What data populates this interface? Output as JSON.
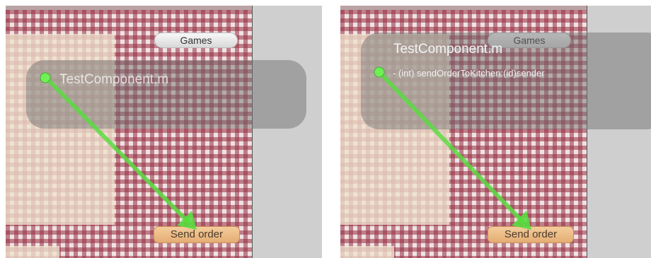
{
  "panels": [
    {
      "component_label": "TestComponent.m",
      "games_button": "Games",
      "send_button": "Send order"
    },
    {
      "component_label": "TestComponent.m",
      "method_label": "- (int) sendOrderToKitchen:(id)sender",
      "games_button": "Games",
      "send_button": "Send order"
    }
  ],
  "colors": {
    "connection_line": "#57dd3e",
    "send_button": "#eebd86",
    "tablecloth": "#9c3046"
  }
}
